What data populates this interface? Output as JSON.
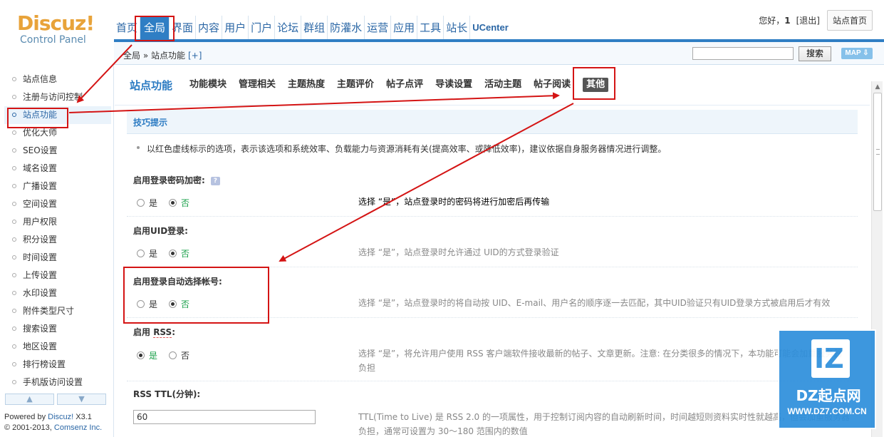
{
  "logo": {
    "title": "Discuz!",
    "subtitle": "Control Panel"
  },
  "topnav": [
    {
      "label": "首页",
      "active": false
    },
    {
      "label": "全局",
      "active": true
    },
    {
      "label": "界面",
      "active": false
    },
    {
      "label": "内容",
      "active": false
    },
    {
      "label": "用户",
      "active": false
    },
    {
      "label": "门户",
      "active": false
    },
    {
      "label": "论坛",
      "active": false
    },
    {
      "label": "群组",
      "active": false
    },
    {
      "label": "防灌水",
      "active": false
    },
    {
      "label": "运营",
      "active": false
    },
    {
      "label": "应用",
      "active": false
    },
    {
      "label": "工具",
      "active": false
    },
    {
      "label": "站长",
      "active": false
    },
    {
      "label": "UCenter",
      "active": false
    }
  ],
  "user": {
    "greeting": "您好，",
    "name": "1",
    "logout": "[退出]",
    "home": "站点首页"
  },
  "breadcrumb": {
    "text": "全局 » 站点功能",
    "add": "[+]"
  },
  "search": {
    "value": "",
    "button": "搜索",
    "map": "MAP ⇩"
  },
  "sidebar": {
    "items": [
      {
        "label": "站点信息",
        "active": false
      },
      {
        "label": "注册与访问控制",
        "active": false
      },
      {
        "label": "站点功能",
        "active": true
      },
      {
        "label": "优化大师",
        "active": false
      },
      {
        "label": "SEO设置",
        "active": false
      },
      {
        "label": "域名设置",
        "active": false
      },
      {
        "label": "广播设置",
        "active": false
      },
      {
        "label": "空间设置",
        "active": false
      },
      {
        "label": "用户权限",
        "active": false
      },
      {
        "label": "积分设置",
        "active": false
      },
      {
        "label": "时间设置",
        "active": false
      },
      {
        "label": "上传设置",
        "active": false
      },
      {
        "label": "水印设置",
        "active": false
      },
      {
        "label": "附件类型尺寸",
        "active": false
      },
      {
        "label": "搜索设置",
        "active": false
      },
      {
        "label": "地区设置",
        "active": false
      },
      {
        "label": "排行榜设置",
        "active": false
      },
      {
        "label": "手机版访问设置",
        "active": false
      }
    ],
    "powered": "Powered by ",
    "powered_brand": "Discuz!",
    "powered_version": " X3.1",
    "copyright": "© 2001-2013, ",
    "copyright_brand": "Comsenz Inc."
  },
  "subnav": {
    "title": "站点功能",
    "tabs": [
      {
        "label": "功能模块",
        "active": false
      },
      {
        "label": "管理相关",
        "active": false
      },
      {
        "label": "主题热度",
        "active": false
      },
      {
        "label": "主题评价",
        "active": false
      },
      {
        "label": "帖子点评",
        "active": false
      },
      {
        "label": "导读设置",
        "active": false
      },
      {
        "label": "活动主题",
        "active": false
      },
      {
        "label": "帖子阅读",
        "active": false
      },
      {
        "label": "其他",
        "active": true
      }
    ]
  },
  "tips": {
    "title": "技巧提示",
    "text": "以红色虚线标示的选项，表示该选项和系统效率、负载能力与资源消耗有关(提高效率、或降低效率)，建议依据自身服务器情况进行调整。"
  },
  "settings": {
    "login_encrypt": {
      "label": "启用登录密码加密:",
      "yes": "是",
      "no": "否",
      "value": "否",
      "desc": "选择 “是”，站点登录时的密码将进行加密后再传输"
    },
    "uid_login": {
      "label": "启用UID登录:",
      "yes": "是",
      "no": "否",
      "value": "否",
      "desc": "选择 “是”，站点登录时允许通过 UID的方式登录验证"
    },
    "auto_account": {
      "label": "启用登录自动选择帐号:",
      "yes": "是",
      "no": "否",
      "value": "否",
      "desc": "选择 “是”，站点登录时的将自动按 UID、E-mail、用户名的顺序逐一去匹配，其中UID验证只有UID登录方式被启用后才有效"
    },
    "rss": {
      "label_a": "启用 ",
      "label_b": "RSS",
      "label_c": ":",
      "yes": "是",
      "no": "否",
      "value": "是",
      "desc_1": "选择 “是”，将允许用户使用 RSS 客户端软件接收最新的帖子、文章更新。注意: 在分类很多的情况下，本功能可能会加重服务器",
      "desc_2": "负担"
    },
    "rss_ttl": {
      "label": "RSS TTL(分钟):",
      "value": "60",
      "desc_1": "TTL(Time to Live) 是 RSS 2.0 的一项属性，用于控制订阅内容的自动刷新时间，时间越短则资料实时性就越高，但会加重服务器",
      "desc_2": "负担，通常可设置为 30～180 范围内的数值"
    }
  },
  "watermark": {
    "letters": "IZ",
    "name": "DZ起点网",
    "url": "WWW.DZ7.COM.CN"
  },
  "colors": {
    "primary": "#2f7ec4",
    "annotation": "#d41414",
    "logo": "#e8a33a"
  }
}
